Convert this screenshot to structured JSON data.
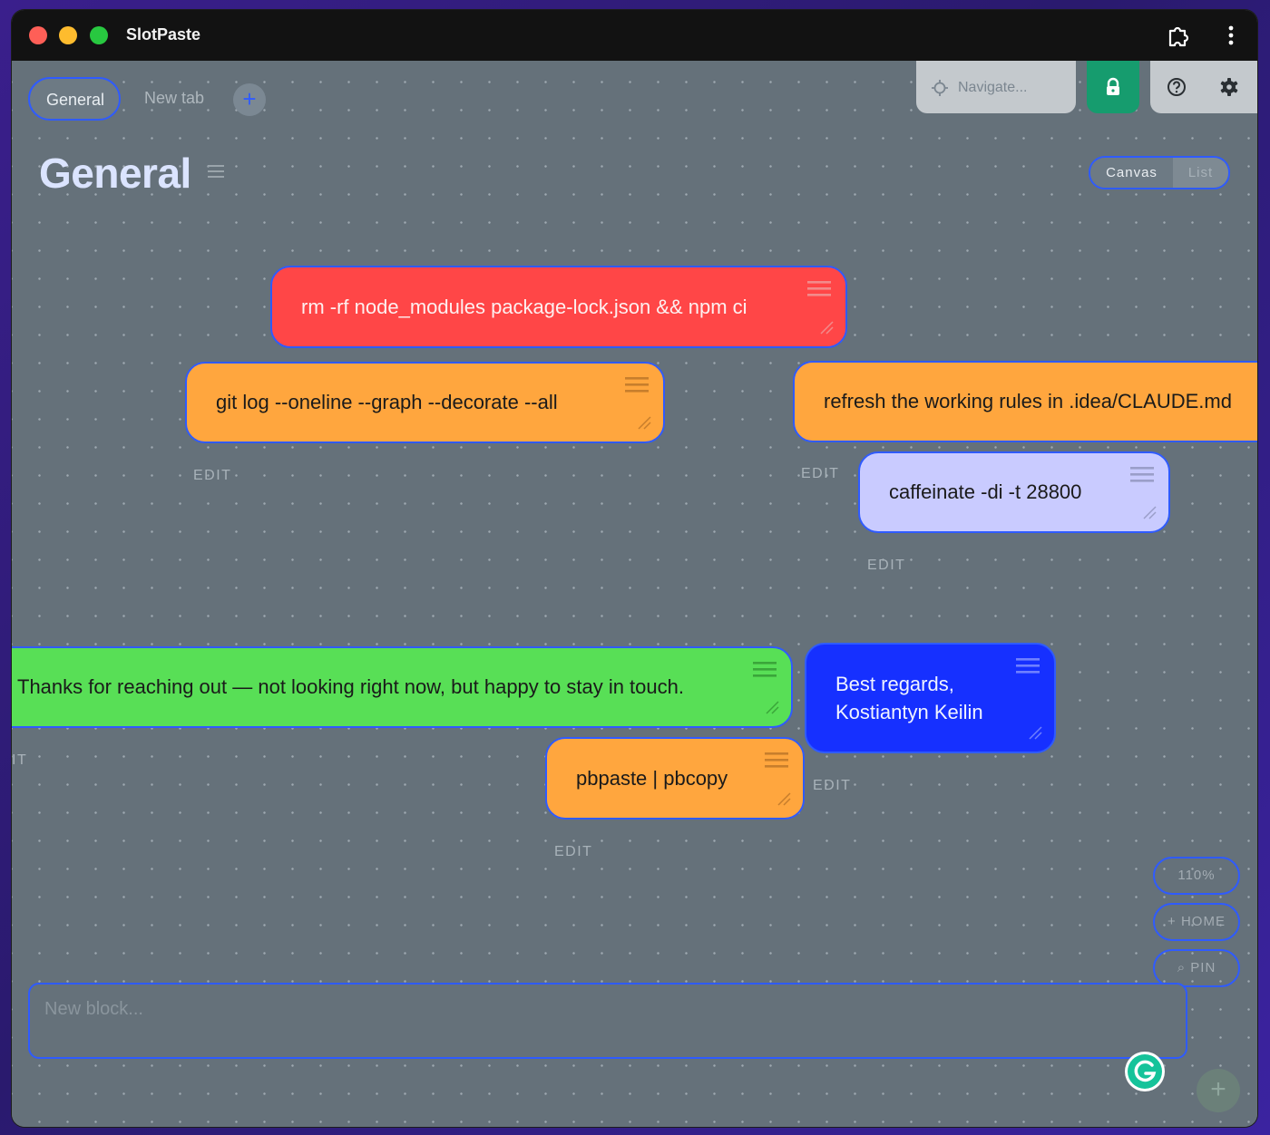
{
  "window": {
    "title": "SlotPaste"
  },
  "tabs": [
    {
      "label": "General",
      "active": true
    },
    {
      "label": "New tab",
      "active": false
    }
  ],
  "toolbar": {
    "add_tab_label": "+",
    "navigate_placeholder": "Navigate...",
    "icons": [
      "extension-icon",
      "more-vertical-icon",
      "crosshair-icon",
      "lock-icon",
      "help-icon",
      "gear-icon"
    ]
  },
  "page": {
    "title": "General"
  },
  "view_toggle": {
    "canvas_label": "Canvas",
    "list_label": "List",
    "selected": "Canvas"
  },
  "blocks": [
    {
      "text": "rm -rf node_modules package-lock.json && npm ci",
      "color": "#ff4647"
    },
    {
      "text": "git log --oneline --graph --decorate --all",
      "color": "#ffa63e"
    },
    {
      "text": "refresh the working rules in .idea/CLAUDE.md",
      "color": "#ffa63e"
    },
    {
      "text": "caffeinate -di -t 28800",
      "color": "#c9cbff"
    },
    {
      "text": "Thanks for reaching out — not looking right now, but happy to stay in touch.",
      "color": "#58df56"
    },
    {
      "text": "Best regards,\nKostiantyn Keilin",
      "color": "#1630ff"
    },
    {
      "text": "pbpaste | pbcopy",
      "color": "#ffa63e"
    }
  ],
  "edit_label": "EDIT",
  "edit_label_partial": "IT",
  "zoom_controls": {
    "zoom": "110%",
    "home": "HOME",
    "pin": "PIN"
  },
  "swatches": [
    "#ffa63e",
    "#111111",
    "#1630ff",
    "#ffffff",
    "rainbow"
  ],
  "composer": {
    "placeholder": "New block...",
    "add_label": "+"
  },
  "accent_color": "#2f5bff"
}
